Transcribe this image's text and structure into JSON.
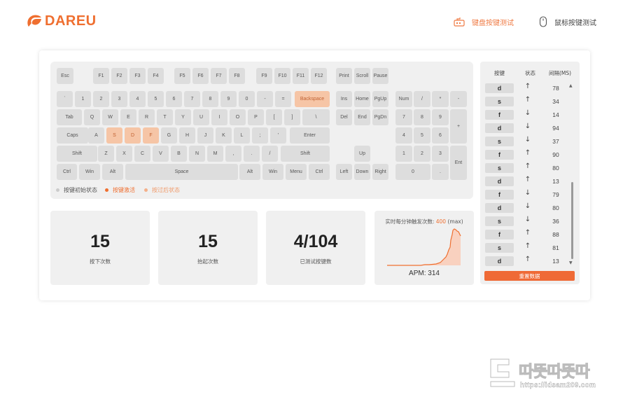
{
  "brand": {
    "name": "DAREU",
    "accent": "#ef6f30"
  },
  "nav": {
    "keyboard_test": "键盘按键测试",
    "mouse_test": "鼠标按键测试",
    "active": "keyboard_test"
  },
  "keyboard": {
    "tested_keys": [
      "Backspace",
      "S",
      "D",
      "F"
    ],
    "function_row": [
      "Esc",
      "F1",
      "F2",
      "F3",
      "F4",
      "F5",
      "F6",
      "F7",
      "F8",
      "F9",
      "F10",
      "F11",
      "F12",
      "Print",
      "Scroll",
      "Pause"
    ],
    "number_row": [
      "`",
      "1",
      "2",
      "3",
      "4",
      "5",
      "6",
      "7",
      "8",
      "9",
      "0",
      "-",
      "=",
      "Backspace",
      "Ins",
      "Home",
      "PgUp",
      "Num",
      "/",
      "*",
      "-"
    ],
    "tab_row": [
      "Tab",
      "Q",
      "W",
      "E",
      "R",
      "T",
      "Y",
      "U",
      "I",
      "O",
      "P",
      "[",
      "]",
      "\\",
      "Del",
      "End",
      "PgDn",
      "7",
      "8",
      "9",
      "+"
    ],
    "caps_row": [
      "Caps",
      "A",
      "S",
      "D",
      "F",
      "G",
      "H",
      "J",
      "K",
      "L",
      ";",
      "'",
      "Enter",
      "4",
      "5",
      "6"
    ],
    "shift_row": [
      "Shift",
      "Z",
      "X",
      "C",
      "V",
      "B",
      "N",
      "M",
      ",",
      ".",
      "/",
      "Shift",
      "Up",
      "1",
      "2",
      "3",
      "Ent"
    ],
    "bottom_row": [
      "Ctrl",
      "Win",
      "Alt",
      "Space",
      "Alt",
      "Win",
      "Menu",
      "Ctrl",
      "Left",
      "Down",
      "Right",
      "0",
      "."
    ]
  },
  "legend": [
    {
      "label": "按键初始状态",
      "color": "#cccccc"
    },
    {
      "label": "按键激活",
      "color": "#ef6f30"
    },
    {
      "label": "按过后状态",
      "color": "#f4b08a"
    }
  ],
  "stats": {
    "press_count": {
      "value": "15",
      "label": "按下次数"
    },
    "release_count": {
      "value": "15",
      "label": "抬起次数"
    },
    "tested_keys": {
      "value": "4/104",
      "label": "已测试按键数"
    }
  },
  "rate": {
    "title_prefix": "实时每分钟触发次数:",
    "max_value": "400",
    "max_suffix": "(max)",
    "apm_text": "APM: 314"
  },
  "log": {
    "headers": {
      "key": "按键",
      "state": "状态",
      "interval": "间隔(MS)"
    },
    "rows": [
      {
        "key": "d",
        "dir": "↑",
        "ms": "78"
      },
      {
        "key": "s",
        "dir": "↑",
        "ms": "34"
      },
      {
        "key": "f",
        "dir": "↓",
        "ms": "14"
      },
      {
        "key": "d",
        "dir": "↓",
        "ms": "94"
      },
      {
        "key": "s",
        "dir": "↓",
        "ms": "37"
      },
      {
        "key": "f",
        "dir": "↑",
        "ms": "90"
      },
      {
        "key": "s",
        "dir": "↑",
        "ms": "80"
      },
      {
        "key": "d",
        "dir": "↑",
        "ms": "13"
      },
      {
        "key": "f",
        "dir": "↓",
        "ms": "79"
      },
      {
        "key": "d",
        "dir": "↓",
        "ms": "80"
      },
      {
        "key": "s",
        "dir": "↓",
        "ms": "36"
      },
      {
        "key": "f",
        "dir": "↑",
        "ms": "88"
      },
      {
        "key": "s",
        "dir": "↑",
        "ms": "81"
      },
      {
        "key": "d",
        "dir": "↑",
        "ms": "13"
      }
    ],
    "reset_label": "重置数据"
  },
  "watermark": {
    "text": "따뜻따뜻따",
    "url": "https://idsam209.com"
  }
}
